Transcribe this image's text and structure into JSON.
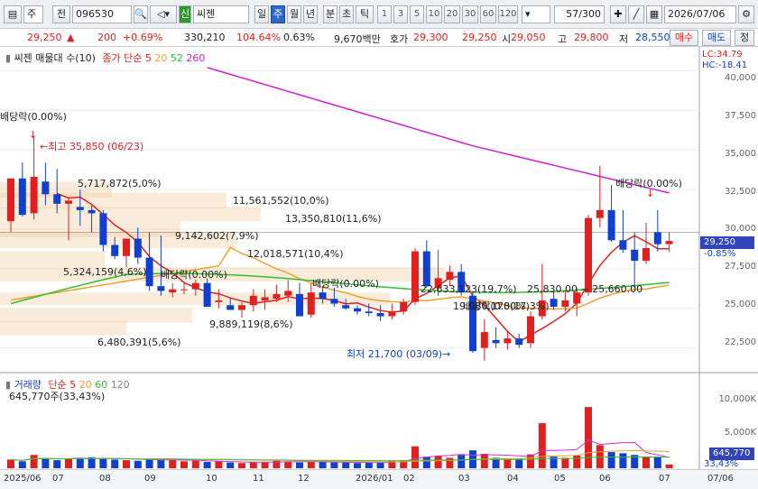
{
  "toolbar": {
    "mode": "주",
    "prev": "전",
    "code": "096530",
    "badge": "신",
    "name": "씨젠",
    "periods": [
      "일",
      "주",
      "월",
      "년",
      "분",
      "초",
      "틱"
    ],
    "active_period": "주",
    "intervals": [
      "1",
      "3",
      "5",
      "10",
      "20",
      "30",
      "60",
      "120"
    ],
    "count": "57/300",
    "date": "2026/07/06"
  },
  "quote": {
    "price": "29,250",
    "change": "200",
    "change_pct": "+0.69%",
    "volume": "330,210",
    "vol_ratio": "104.64%",
    "turnover": "0.63%",
    "amount": "9,670백만",
    "ask_label": "호가",
    "ask": "29,300",
    "bid": "29,250",
    "open_label": "시",
    "open": "29,050",
    "high_label": "고",
    "high": "29,800",
    "low_label": "저",
    "low": "28,550",
    "buy_label": "매수",
    "sell_label": "매도",
    "order_label": "정"
  },
  "price_legend": {
    "title": "씨젠 매물대 수(10)",
    "ma_label": "종가 단순 5",
    "ma20": "20",
    "ma52": "52",
    "ma260": "260",
    "lc": "LC:34.79",
    "hc": "HC:-18.41"
  },
  "price_axis": [
    "40,000",
    "37,500",
    "35,000",
    "32,500",
    "30,000",
    "27,500",
    "25,000",
    "22,500"
  ],
  "current_price_tag": "29,250",
  "current_pct": "-0.85%",
  "annotations": {
    "div1": "배당락(0.00%)",
    "high": "최고 35,850 (06/23)",
    "div2": "배당락(0.00%)",
    "div3": "배당락(0.00%)",
    "div4": "배당락(0.00%)",
    "div5": "배당락(0.00%)",
    "low": "최저 21,700 (03/09)"
  },
  "volume_profile": [
    "5,717,872(5,0%)",
    "11,561,552(10,0%)",
    "13,350,810(11,6%)",
    "9,142,602(7,9%)",
    "12,018,571(10,4%)",
    "5,324,159(4,6%)",
    "9,889,119(8,6%)",
    "6,480,391(5,6%)",
    "22,633,123(19,7%)",
    "19,980,178(17,3%)",
    "25,830.00 ~ 25,660.00"
  ],
  "volume_legend": {
    "title": "거래량",
    "ma_label": "단순 5",
    "ma20": "20",
    "ma60": "60",
    "ma120": "120",
    "current": "645,770주(33,43%)"
  },
  "volume_axis": [
    "10,000K",
    "5,000K"
  ],
  "volume_tag": "645,770",
  "volume_pct": "33,43%",
  "date_axis": [
    "2025/06",
    "07",
    "08",
    "09",
    "10",
    "11",
    "12",
    "2026/01",
    "02",
    "03",
    "04",
    "05",
    "06",
    "07",
    "07/06"
  ],
  "colors": {
    "up": "#e02020",
    "down": "#1040d0",
    "ma5": "#e02020",
    "ma20": "#f0a030",
    "ma52": "#30c030",
    "ma260": "#d020d0"
  },
  "chart_data": {
    "type": "candlestick",
    "unit": "KRW",
    "ylim": [
      21000,
      41500
    ],
    "candles": [
      {
        "o": 30500,
        "h": 33200,
        "l": 29800,
        "c": 33200
      },
      {
        "o": 33200,
        "h": 34200,
        "l": 30800,
        "c": 30900
      },
      {
        "o": 31000,
        "h": 35850,
        "l": 30600,
        "c": 33300
      },
      {
        "o": 33000,
        "h": 34200,
        "l": 31500,
        "c": 32200
      },
      {
        "o": 32200,
        "h": 33800,
        "l": 31000,
        "c": 31600
      },
      {
        "o": 31600,
        "h": 32000,
        "l": 29300,
        "c": 31800
      },
      {
        "o": 31400,
        "h": 32500,
        "l": 30200,
        "c": 31200
      },
      {
        "o": 31200,
        "h": 31500,
        "l": 29800,
        "c": 31000
      },
      {
        "o": 31000,
        "h": 31200,
        "l": 28600,
        "c": 29000
      },
      {
        "o": 29000,
        "h": 29500,
        "l": 28100,
        "c": 28300
      },
      {
        "o": 28300,
        "h": 29400,
        "l": 27600,
        "c": 29400
      },
      {
        "o": 29400,
        "h": 30100,
        "l": 27800,
        "c": 28200
      },
      {
        "o": 28200,
        "h": 29800,
        "l": 26100,
        "c": 26400
      },
      {
        "o": 26400,
        "h": 29600,
        "l": 25800,
        "c": 26100
      },
      {
        "o": 26000,
        "h": 26600,
        "l": 25700,
        "c": 26200
      },
      {
        "o": 26200,
        "h": 26600,
        "l": 25900,
        "c": 26200
      },
      {
        "o": 26200,
        "h": 26800,
        "l": 25800,
        "c": 26600
      },
      {
        "o": 26600,
        "h": 26900,
        "l": 25100,
        "c": 25100
      },
      {
        "o": 25400,
        "h": 26200,
        "l": 25000,
        "c": 25500
      },
      {
        "o": 25200,
        "h": 25700,
        "l": 24900,
        "c": 24900
      },
      {
        "o": 24900,
        "h": 25400,
        "l": 24400,
        "c": 25200
      },
      {
        "o": 25200,
        "h": 26200,
        "l": 24800,
        "c": 25800
      },
      {
        "o": 25500,
        "h": 26200,
        "l": 24900,
        "c": 25700
      },
      {
        "o": 25600,
        "h": 26500,
        "l": 25400,
        "c": 25900
      },
      {
        "o": 25800,
        "h": 26800,
        "l": 25400,
        "c": 26100
      },
      {
        "o": 25900,
        "h": 26600,
        "l": 24500,
        "c": 24500
      },
      {
        "o": 24600,
        "h": 26600,
        "l": 24400,
        "c": 26000
      },
      {
        "o": 26000,
        "h": 26400,
        "l": 25300,
        "c": 25600
      },
      {
        "o": 25600,
        "h": 26300,
        "l": 25100,
        "c": 25300
      },
      {
        "o": 25200,
        "h": 25600,
        "l": 24900,
        "c": 25000
      },
      {
        "o": 25000,
        "h": 25200,
        "l": 24600,
        "c": 24800
      },
      {
        "o": 24800,
        "h": 25300,
        "l": 24500,
        "c": 24700
      },
      {
        "o": 24700,
        "h": 25200,
        "l": 24200,
        "c": 24500
      },
      {
        "o": 24500,
        "h": 25300,
        "l": 24300,
        "c": 24800
      },
      {
        "o": 24800,
        "h": 25600,
        "l": 24600,
        "c": 25400
      },
      {
        "o": 25400,
        "h": 28800,
        "l": 25200,
        "c": 28600
      },
      {
        "o": 28600,
        "h": 29300,
        "l": 26300,
        "c": 26400
      },
      {
        "o": 26300,
        "h": 28700,
        "l": 25800,
        "c": 26900
      },
      {
        "o": 26800,
        "h": 27700,
        "l": 26400,
        "c": 27300
      },
      {
        "o": 27300,
        "h": 27800,
        "l": 25800,
        "c": 26000
      },
      {
        "o": 25800,
        "h": 26000,
        "l": 22200,
        "c": 22300
      },
      {
        "o": 22500,
        "h": 24300,
        "l": 21700,
        "c": 23500
      },
      {
        "o": 23000,
        "h": 23800,
        "l": 22500,
        "c": 22800
      },
      {
        "o": 22800,
        "h": 23600,
        "l": 22400,
        "c": 23100
      },
      {
        "o": 23100,
        "h": 23400,
        "l": 22500,
        "c": 22700
      },
      {
        "o": 22800,
        "h": 24800,
        "l": 22500,
        "c": 24500
      },
      {
        "o": 24500,
        "h": 27800,
        "l": 24300,
        "c": 25500
      },
      {
        "o": 25600,
        "h": 26100,
        "l": 24900,
        "c": 25100
      },
      {
        "o": 25100,
        "h": 26100,
        "l": 24800,
        "c": 25500
      },
      {
        "o": 25300,
        "h": 26300,
        "l": 24500,
        "c": 26000
      },
      {
        "o": 26000,
        "h": 30900,
        "l": 25800,
        "c": 30700
      },
      {
        "o": 30700,
        "h": 34000,
        "l": 30100,
        "c": 31200
      },
      {
        "o": 31200,
        "h": 32800,
        "l": 29200,
        "c": 29300
      },
      {
        "o": 29300,
        "h": 31200,
        "l": 28500,
        "c": 28700
      },
      {
        "o": 28700,
        "h": 29800,
        "l": 26300,
        "c": 28000
      },
      {
        "o": 28000,
        "h": 30400,
        "l": 27800,
        "c": 28800
      },
      {
        "o": 29800,
        "h": 31200,
        "l": 28600,
        "c": 29050
      },
      {
        "o": 29050,
        "h": 29800,
        "l": 28550,
        "c": 29250
      }
    ],
    "volume": [
      1.5,
      1.2,
      2.3,
      1.8,
      1.4,
      1.6,
      1.7,
      1.9,
      1.8,
      1.5,
      1.4,
      1.3,
      1.6,
      1.5,
      1.4,
      1.2,
      1.3,
      1.1,
      1.2,
      1.0,
      0.9,
      1.1,
      1.0,
      1.3,
      1.2,
      1.0,
      1.1,
      1.1,
      1.0,
      1.0,
      0.9,
      1.0,
      1.0,
      1.3,
      1.4,
      3.8,
      2.0,
      2.1,
      1.8,
      2.3,
      3.1,
      2.5,
      1.8,
      1.6,
      1.7,
      2.4,
      7.8,
      2.0,
      1.8,
      2.2,
      10.6,
      4.0,
      2.8,
      2.6,
      2.3,
      2.0,
      1.9,
      0.65
    ]
  }
}
